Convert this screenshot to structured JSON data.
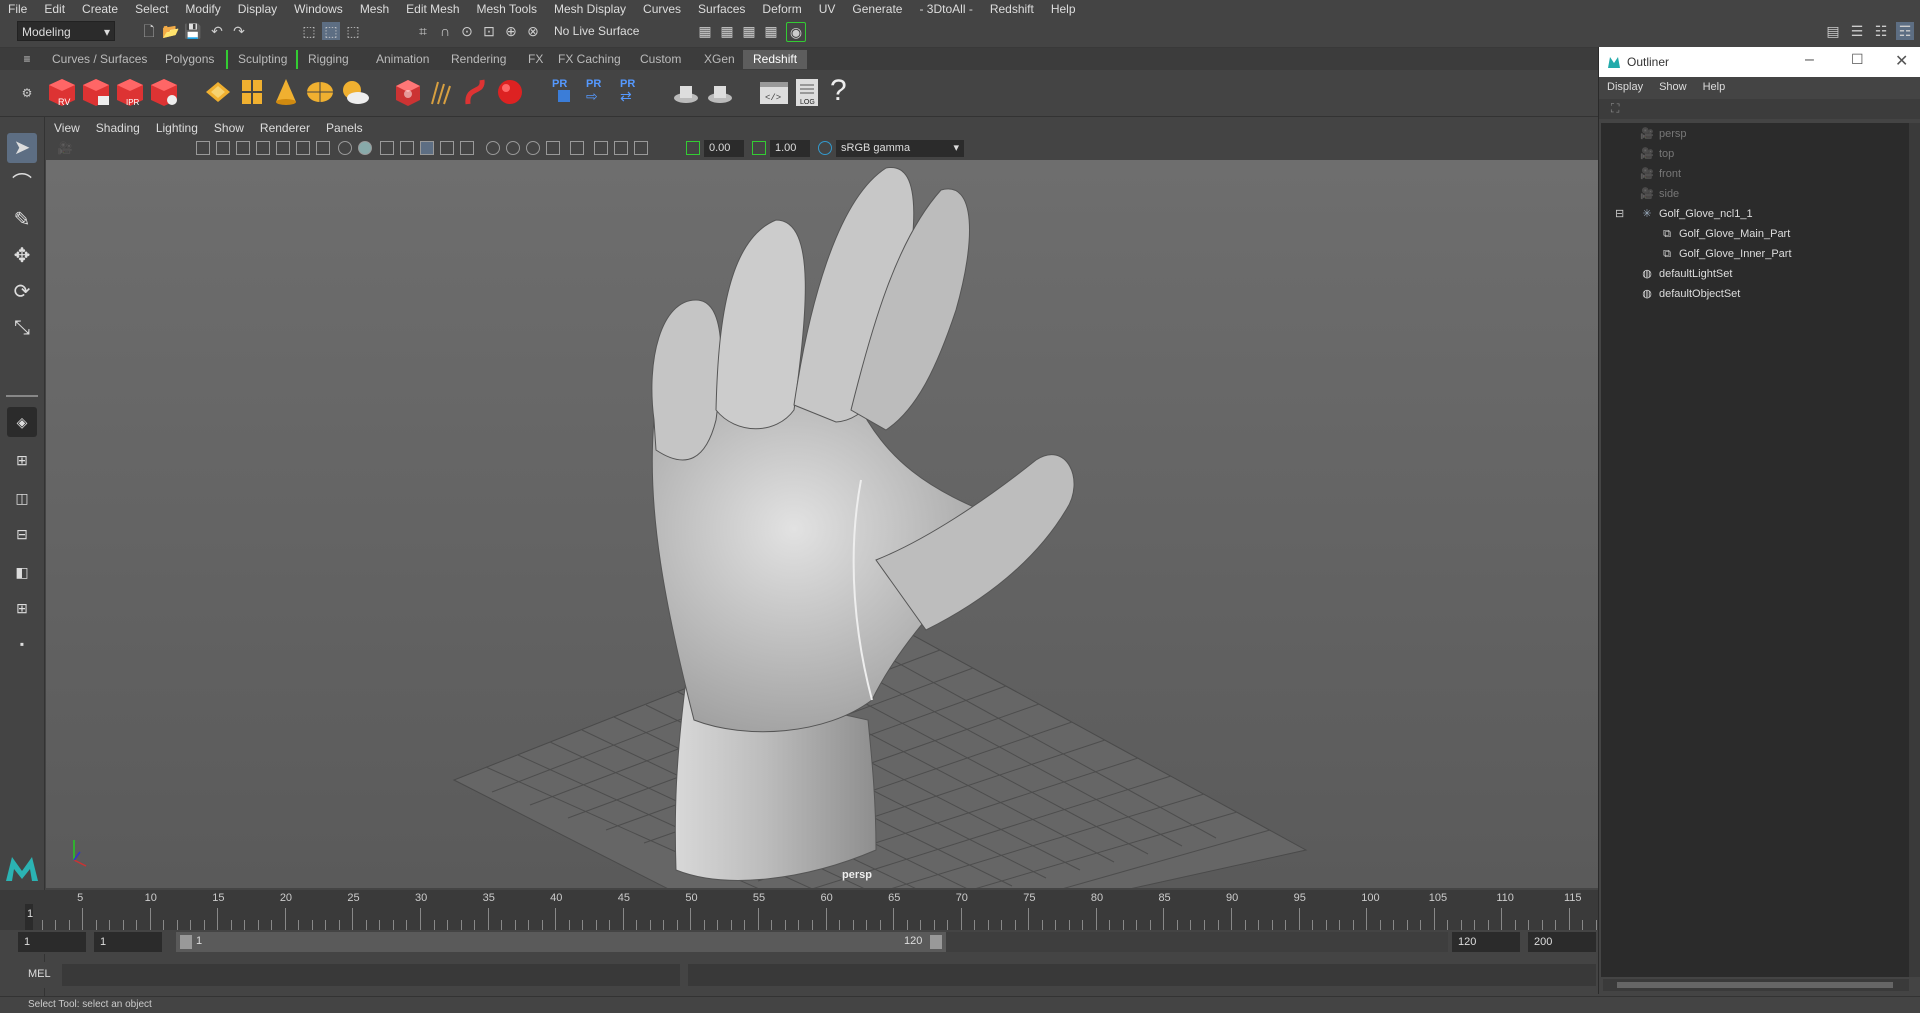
{
  "menubar": [
    "File",
    "Edit",
    "Create",
    "Select",
    "Modify",
    "Display",
    "Windows",
    "Mesh",
    "Edit Mesh",
    "Mesh Tools",
    "Mesh Display",
    "Curves",
    "Surfaces",
    "Deform",
    "UV",
    "Generate",
    "- 3DtoAll -",
    "Redshift",
    "Help"
  ],
  "statusline": {
    "mode": "Modeling",
    "live_surface": "No Live Surface"
  },
  "shelf_tabs": [
    "Curves / Surfaces",
    "Polygons",
    "Sculpting",
    "Rigging",
    "Animation",
    "Rendering",
    "FX",
    "FX Caching",
    "Custom",
    "XGen",
    "Redshift"
  ],
  "shelf_active": "Redshift",
  "shelf_icons": {
    "rv": "RV",
    "ipr": "IPR",
    "pr_labels": [
      "PR",
      "PR",
      "PR"
    ],
    "log": "LOG",
    "help": "?"
  },
  "viewport": {
    "menu": [
      "View",
      "Shading",
      "Lighting",
      "Show",
      "Renderer",
      "Panels"
    ],
    "exposure": "0.00",
    "gamma": "1.00",
    "color_space": "sRGB gamma",
    "camera": "persp"
  },
  "timeline": {
    "ticks": [
      "5",
      "10",
      "15",
      "20",
      "25",
      "30",
      "35",
      "40",
      "45",
      "50",
      "55",
      "60",
      "65",
      "70",
      "75",
      "80",
      "85",
      "90",
      "95",
      "100",
      "105",
      "110",
      "115"
    ],
    "current_frame": "1"
  },
  "range": {
    "start": "1",
    "anim_start": "1",
    "slider_start": "1",
    "slider_end": "120",
    "end": "120",
    "anim_end": "200"
  },
  "mel": {
    "label": "MEL"
  },
  "helpline": "Select Tool: select an object",
  "outliner": {
    "title": "Outliner",
    "menu": [
      "Display",
      "Show",
      "Help"
    ],
    "items": [
      {
        "label": "persp",
        "type": "camera",
        "indent": 1,
        "dim": true
      },
      {
        "label": "top",
        "type": "camera",
        "indent": 1,
        "dim": true
      },
      {
        "label": "front",
        "type": "camera",
        "indent": 1,
        "dim": true
      },
      {
        "label": "side",
        "type": "camera",
        "indent": 1,
        "dim": true
      },
      {
        "label": "Golf_Glove_ncl1_1",
        "type": "group",
        "indent": 1,
        "dim": false
      },
      {
        "label": "Golf_Glove_Main_Part",
        "type": "mesh",
        "indent": 2,
        "dim": false
      },
      {
        "label": "Golf_Glove_Inner_Part",
        "type": "mesh",
        "indent": 2,
        "dim": false
      },
      {
        "label": "defaultLightSet",
        "type": "set",
        "indent": 1,
        "dim": false
      },
      {
        "label": "defaultObjectSet",
        "type": "set",
        "indent": 1,
        "dim": false
      }
    ]
  },
  "colors": {
    "accent_green": "#3c3",
    "redshift_red": "#d33",
    "maya_teal": "#2aa"
  }
}
